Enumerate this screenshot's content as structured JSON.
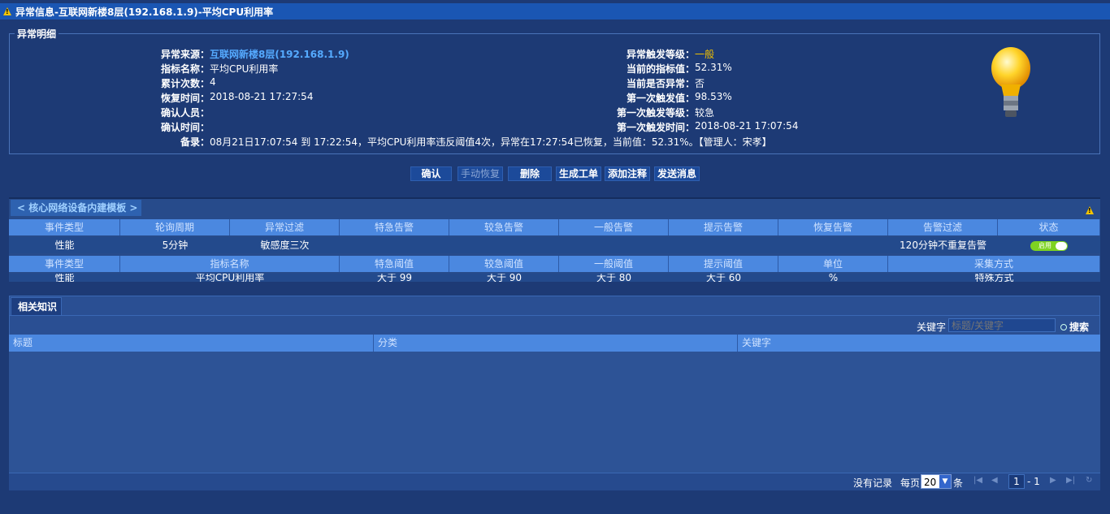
{
  "window": {
    "title": "异常信息-互联网新楼8层(192.168.1.9)-平均CPU利用率"
  },
  "detail": {
    "legend": "异常明细",
    "left": [
      {
        "label": "异常来源：",
        "value": "互联网新楼8层(192.168.1.9)"
      },
      {
        "label": "指标名称：",
        "value": "平均CPU利用率"
      },
      {
        "label": "累计次数：",
        "value": "4"
      },
      {
        "label": "恢复时间：",
        "value": "2018-08-21 17:27:54"
      },
      {
        "label": "确认人员：",
        "value": ""
      },
      {
        "label": "确认时间：",
        "value": ""
      }
    ],
    "right": [
      {
        "label": "异常触发等级：",
        "value": "一般"
      },
      {
        "label": "当前的指标值：",
        "value": "52.31%"
      },
      {
        "label": "当前是否异常：",
        "value": "否"
      },
      {
        "label": "第一次触发值：",
        "value": "98.53%"
      },
      {
        "label": "第一次触发等级：",
        "value": "较急"
      },
      {
        "label": "第一次触发时间：",
        "value": "2018-08-21 17:07:54"
      }
    ],
    "remark_label": "备录：",
    "remark_value": "08月21日17:07:54 到 17:22:54，平均CPU利用率违反阈值4次，异常在17:27:54已恢复，当前值：52.31%。【管理人：宋孝】"
  },
  "actions": {
    "confirm": "确认",
    "manual_recover": "手动恢复",
    "delete": "删除",
    "create_ticket": "生成工单",
    "add_note": "添加注释",
    "send_message": "发送消息"
  },
  "template": {
    "tab": "< 核心网络设备内建模板 >",
    "headers1": [
      "事件类型",
      "轮询周期",
      "异常过滤",
      "特急告警",
      "较急告警",
      "一般告警",
      "提示告警",
      "恢复告警",
      "告警过滤",
      "状态"
    ],
    "row1": [
      "性能",
      "5分钟",
      "敏感度三次",
      "",
      "",
      "",
      "",
      "",
      "120分钟不重复告警",
      ""
    ],
    "status_toggle": "启用",
    "headers2": [
      "事件类型",
      "指标名称",
      "特急阈值",
      "较急阈值",
      "一般阈值",
      "提示阈值",
      "单位",
      "采集方式"
    ],
    "row2": [
      "性能",
      "平均CPU利用率",
      "大于 99",
      "大于 90",
      "大于 80",
      "大于 60",
      "%",
      "特殊方式"
    ]
  },
  "knowledge": {
    "tab": "相关知识",
    "keyword_label": "关键字",
    "keyword_placeholder": "标题/关键字",
    "search": "搜索",
    "columns": [
      "标题",
      "分类",
      "关键字"
    ],
    "pager": {
      "no_records": "没有记录",
      "per_page": "每页",
      "page_size": "20",
      "unit": "条",
      "page": "1",
      "total": "- 1"
    }
  }
}
